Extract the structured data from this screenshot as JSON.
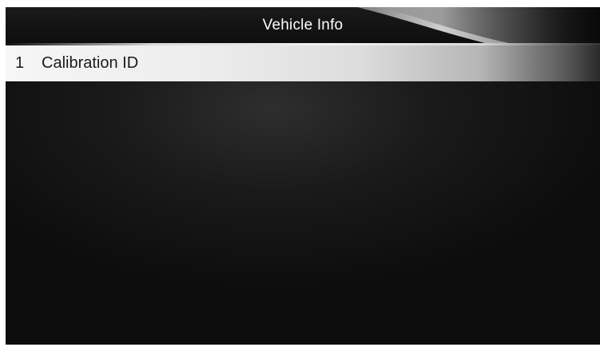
{
  "header": {
    "title": "Vehicle Info"
  },
  "menu": {
    "items": [
      {
        "index": "1",
        "label": "Calibration ID"
      }
    ]
  },
  "colors": {
    "header_bg": "#111111",
    "screen_bg": "#1a1a1a",
    "selected_row": "#ececec",
    "title_text": "#ffffff",
    "item_text": "#1b1b1b"
  }
}
